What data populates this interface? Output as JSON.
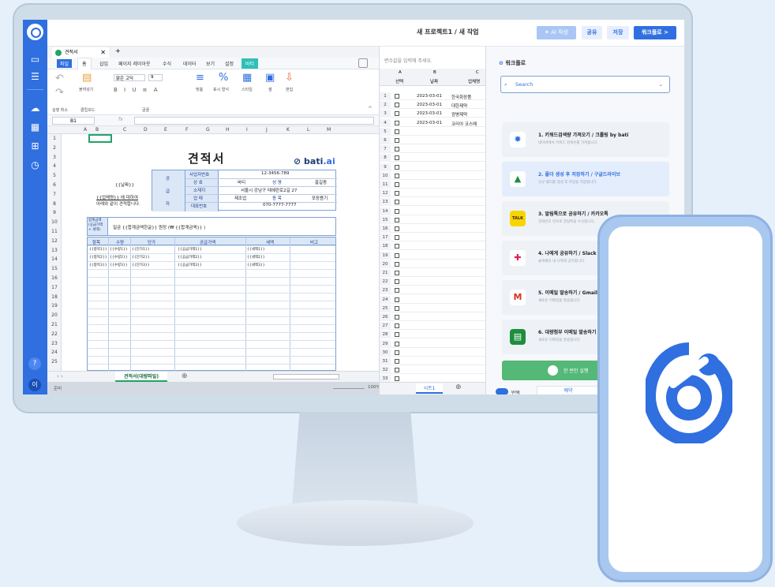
{
  "header": {
    "title": "새 프로젝트1  /  새 작업",
    "ai_button": "AI 작성",
    "share_button": "공유",
    "save_button": "저장",
    "workflow_button": "워크플로 >"
  },
  "rail": {
    "help": "?",
    "user": "이"
  },
  "document": {
    "tab_label": "견적서",
    "add_tab": "+"
  },
  "ribbon": {
    "tabs": [
      "파일",
      "홈",
      "삽입",
      "페이지 레이아웃",
      "수식",
      "데이터",
      "보기",
      "설정",
      "바티"
    ],
    "paste_label": "붙여넣기",
    "font_name": "맑은 고딕",
    "font_size": "9",
    "align_label": "맞춤",
    "number_format_label": "표시 형식",
    "style_label": "스타일",
    "cells_label": "셀",
    "edit_label": "편집",
    "group_undo": "실행 취소",
    "group_clipboard": "클립보드",
    "group_font": "글꼴"
  },
  "formula_bar": {
    "cell_ref": "B1",
    "fx": "fx"
  },
  "columns": [
    "A",
    "B",
    "C",
    "D",
    "E",
    "F",
    "G",
    "H",
    "I",
    "J",
    "K",
    "L",
    "M"
  ],
  "rows": [
    "1",
    "2",
    "3",
    "4",
    "5",
    "6",
    "7",
    "8",
    "9",
    "10",
    "11",
    "12",
    "13",
    "14",
    "15",
    "16",
    "17",
    "18",
    "19",
    "20",
    "21",
    "22",
    "23",
    "24",
    "25"
  ],
  "estimate": {
    "title": "견적서",
    "brand_prefix": "bati",
    "brand_suffix": ".ai",
    "recipient": "{{날짜}}",
    "company_line": "{{업체명}}   에 대하여",
    "note": "아래와 같이 견적합니다.",
    "supplier_vertical": [
      "공",
      "급",
      "자"
    ],
    "supplier_labels": [
      "사업자번호",
      "상 호",
      "소재지",
      "업 태",
      "대표번호"
    ],
    "business_no": "12-3456-789",
    "company": "바티",
    "name_label": "성 명",
    "name": "홍길동",
    "address": "서울시 강남구 테헤란로2길 27",
    "biz_type": "제조업",
    "item_label": "종 목",
    "item_value": "포장용기",
    "phone": "070-7777-7777",
    "total_label": "합계금액 (공급가액 + 세액)",
    "total_text": "일금       {{합계금액한글}}      원정 (₩     {{합계금액}}     )",
    "item_headers": [
      "항목",
      "수량",
      "단가",
      "공급가액",
      "세액",
      "비고"
    ],
    "item_rows": [
      [
        "{{항목1}}",
        "{{수량1}}",
        "{{단가1}}",
        "{{공급가액1}}",
        "{{세액1}}"
      ],
      [
        "{{항목2}}",
        "{{수량2}}",
        "{{단가2}}",
        "{{공급가액2}}",
        "{{세액2}}"
      ],
      [
        "{{항목3}}",
        "{{수량3}}",
        "{{단가3}}",
        "{{공급가액3}}",
        "{{세액3}}"
      ]
    ]
  },
  "sheet_tab": "견적서(대량파일)",
  "status": {
    "left": "준비",
    "zoom": "100%"
  },
  "data_panel": {
    "hint": "변수값을 입력해 주세요.",
    "col_letters": [
      "A",
      "B",
      "C"
    ],
    "col_names": [
      "선택",
      "날짜",
      "업체명"
    ],
    "rows": [
      {
        "n": "1",
        "date": "2023-03-01",
        "company": "한국화장품"
      },
      {
        "n": "2",
        "date": "2023-03-01",
        "company": "대한제약"
      },
      {
        "n": "3",
        "date": "2023-03-01",
        "company": "광병제약"
      },
      {
        "n": "4",
        "date": "2023-03-01",
        "company": "코리아 코스메"
      }
    ],
    "row_numbers": [
      "1",
      "2",
      "3",
      "4",
      "5",
      "6",
      "7",
      "8",
      "9",
      "10",
      "11",
      "12",
      "13",
      "14",
      "15",
      "16",
      "17",
      "18",
      "19",
      "20",
      "21",
      "22",
      "23",
      "24",
      "25",
      "26",
      "27",
      "28",
      "29",
      "30",
      "31",
      "32",
      "33"
    ],
    "sheet_tab": "시트1"
  },
  "workflow": {
    "title": "워크플로",
    "search_placeholder": "Search",
    "cards": [
      {
        "title": "1. 키워드검색량 가져오기  /  크롤링 by bati",
        "sub": "네이버에서 키워드 검색수를 가져옵니다."
      },
      {
        "title": "2. 폴더 생성 후 저장하기  /  구글드라이브",
        "sub": "신규 폴더를 생성 후 파일을 저장합니다."
      },
      {
        "title": "3. 알림톡으로 공유하기  /  카카오톡",
        "sub": "전화번호 번호로 알림톡을 수신합니다."
      },
      {
        "title": "4. 나에게 공유하기  /  Slack",
        "sub": "슬랙채널 내 나에게 공유합니다."
      },
      {
        "title": "5. 이메일 발송하기  /  Gmail",
        "sub": "새로운 이메일을 발송합니다."
      },
      {
        "title": "6. 대량첨부 이메일 발송하기",
        "sub": "새로운 이메일을 발송합니다."
      }
    ],
    "icon_colors": [
      "#ffffff",
      "#ffffff",
      "#3c1e1e",
      "#ffffff",
      "#ffffff",
      "#1e8e3e"
    ],
    "run_button": "한 번만 실행",
    "repeat_label": "반복",
    "schedule_label": "예약"
  },
  "brand_colors": {
    "primary": "#2f6fe0",
    "accent": "#2fc0b8",
    "success": "#54b877"
  }
}
